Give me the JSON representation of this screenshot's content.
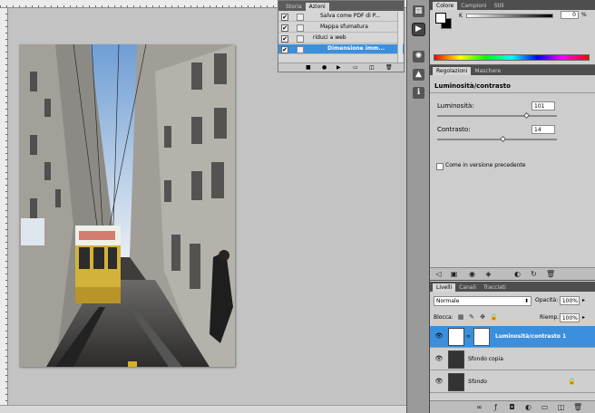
{
  "actions_panel": {
    "tabs": [
      "Storia",
      "Azioni"
    ],
    "active_tab": "Azioni",
    "rows": [
      {
        "label": "Salva come PDF di P...",
        "checked": true,
        "indent": 2,
        "selected": false
      },
      {
        "label": "Mappa sfumatura",
        "checked": true,
        "indent": 2,
        "selected": false
      },
      {
        "label": "riduci a web",
        "checked": true,
        "indent": 1,
        "selected": false
      },
      {
        "label": "Dimensione imm...",
        "checked": true,
        "indent": 2,
        "selected": true
      }
    ]
  },
  "color_panel": {
    "tabs": [
      "Colore",
      "Campioni",
      "Stili"
    ],
    "channel_label": "K",
    "channel_value": "0",
    "unit": "%",
    "foreground": "#ffffff",
    "background": "#000000"
  },
  "adjustments_panel": {
    "tabs": [
      "Regolazioni",
      "Maschere"
    ],
    "title": "Luminosità/contrasto",
    "brightness_label": "Luminosità:",
    "brightness_value": "101",
    "brightness_level": 0.75,
    "contrast_label": "Contrasto:",
    "contrast_value": "14",
    "contrast_level": 0.55,
    "legacy_label": "Come in versione precedente",
    "legacy_checked": false
  },
  "layers_panel": {
    "tabs": [
      "Livelli",
      "Canali",
      "Tracciati"
    ],
    "blend_mode": "Normale",
    "opacity_label": "Opacità:",
    "opacity_value": "100%",
    "lock_label": "Blocca:",
    "fill_label": "Riemp.:",
    "fill_value": "100%",
    "layers": [
      {
        "name": "Luminosità/contrasto 1",
        "selected": true,
        "adjustment": true
      },
      {
        "name": "Sfondo copia",
        "selected": false,
        "adjustment": false
      },
      {
        "name": "Sfondo",
        "selected": false,
        "adjustment": false,
        "locked": true
      }
    ]
  },
  "accent_color": "#3b8fdc"
}
